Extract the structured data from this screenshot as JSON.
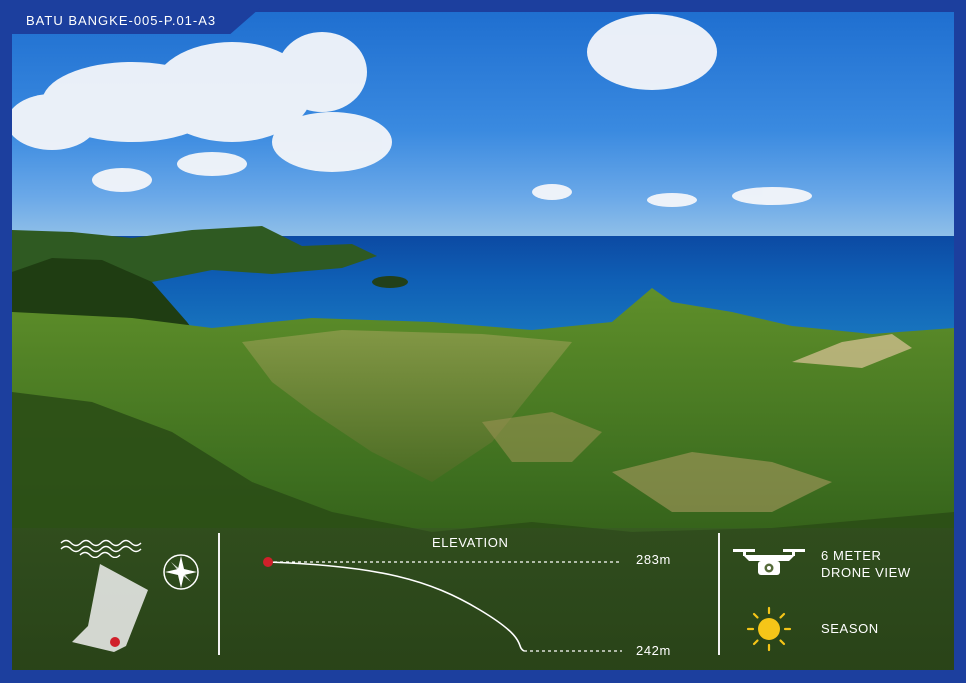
{
  "card": {
    "title": "BATU BANGKE-005-P.01-A3"
  },
  "elevation": {
    "label": "ELEVATION",
    "high": "283m",
    "low": "242m"
  },
  "drone": {
    "line1": "6 METER",
    "line2": "DRONE VIEW"
  },
  "season": {
    "label": "SEASON"
  },
  "icons": [
    "waves-icon",
    "compass-icon",
    "map-plot-icon",
    "drone-icon",
    "sun-icon"
  ],
  "colors": {
    "frame": "#1c3f9e",
    "marker": "#d0202a",
    "sun": "#f5c518"
  }
}
